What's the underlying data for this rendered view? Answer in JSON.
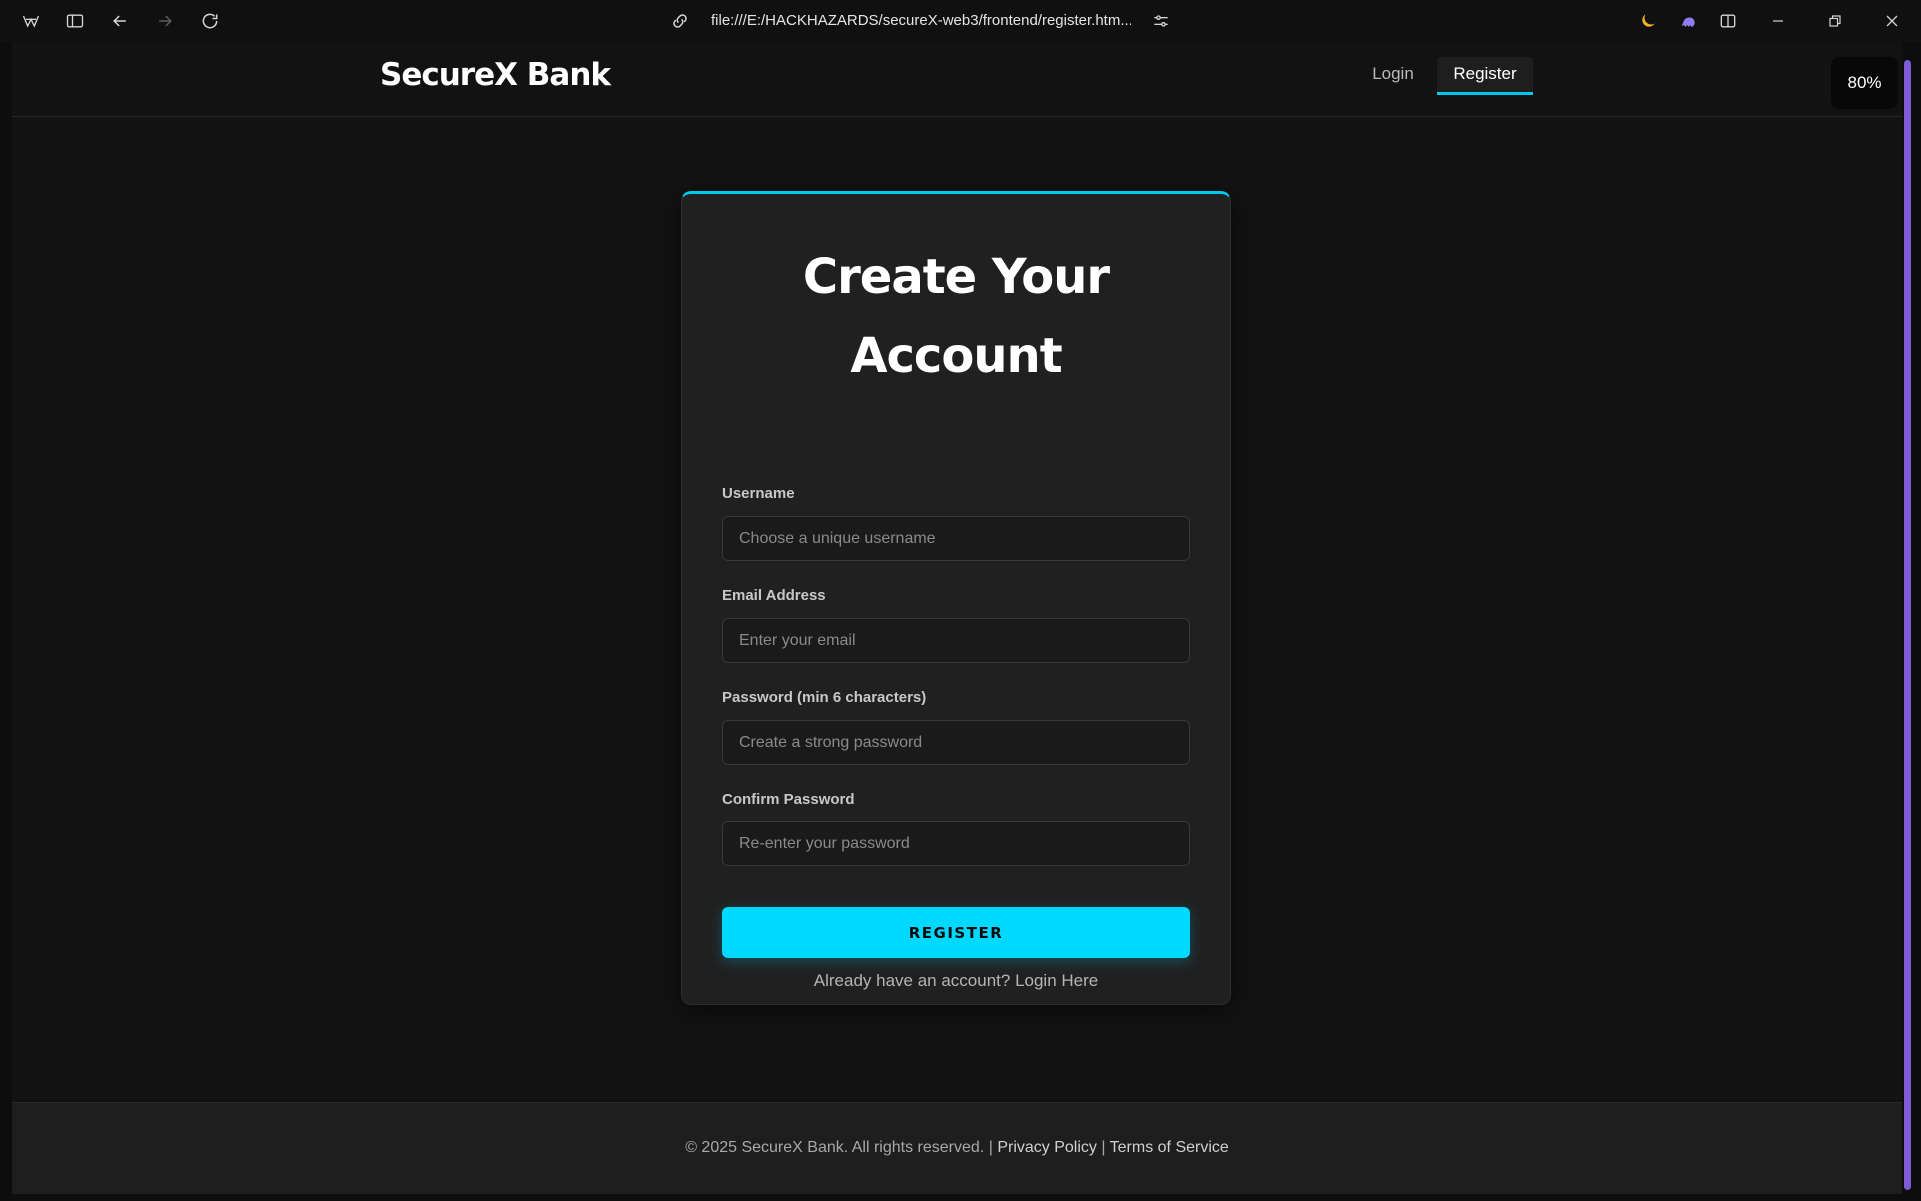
{
  "browser": {
    "url": "file:///E:/HACKHAZARDS/secureX-web3/frontend/register.htm..."
  },
  "navbar": {
    "brand": "SecureX Bank",
    "links": [
      {
        "label": "Login",
        "active": false
      },
      {
        "label": "Register",
        "active": true
      }
    ]
  },
  "zoom": "80%",
  "form": {
    "title_line1": "Create Your",
    "title_line2": "Account",
    "fields": [
      {
        "label": "Username",
        "placeholder": "Choose a unique username"
      },
      {
        "label": "Email Address",
        "placeholder": "Enter your email"
      },
      {
        "label": "Password (min 6 characters)",
        "placeholder": "Create a strong password"
      },
      {
        "label": "Confirm Password",
        "placeholder": "Re-enter your password"
      }
    ],
    "submit_label": "REGISTER",
    "login_prompt": "Already have an account? Login Here"
  },
  "footer": {
    "copyright": "© 2025 SecureX Bank. All rights reserved.",
    "separator": "|",
    "privacy": "Privacy Policy",
    "terms": "Terms of Service"
  },
  "colors": {
    "accent": "#00d9ff",
    "background": "#121212",
    "card": "#202020",
    "scrollbar": "#7d5cd6"
  }
}
